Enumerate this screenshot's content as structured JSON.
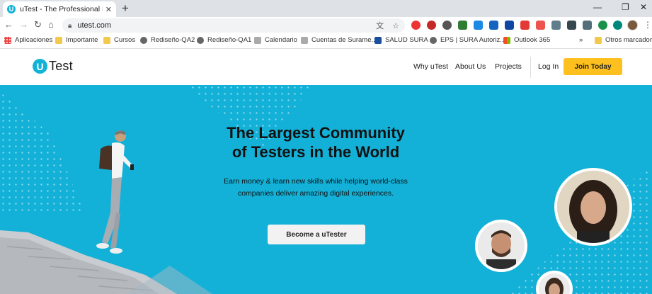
{
  "browser": {
    "tab_title": "uTest - The Professional Network",
    "tab_favicon": "U",
    "url": "utest.com",
    "bookmarks": [
      {
        "label": "Aplicaciones",
        "icon": "apps-icon"
      },
      {
        "label": "Importante",
        "icon": "folder-icon"
      },
      {
        "label": "Cursos",
        "icon": "folder-icon"
      },
      {
        "label": "Rediseño-QA2",
        "icon": "globe-icon"
      },
      {
        "label": "Rediseño-QA1",
        "icon": "globe-icon"
      },
      {
        "label": "Calendario",
        "icon": "calendar-icon"
      },
      {
        "label": "Cuentas de Surame...",
        "icon": "link-icon"
      },
      {
        "label": "SALUD SURA",
        "icon": "sura-icon"
      },
      {
        "label": "EPS | SURA Autoriz...",
        "icon": "globe-icon"
      },
      {
        "label": "Outlook 365",
        "icon": "microsoft-icon"
      }
    ],
    "more_bookmarks": "»",
    "other_bookmarks": "Otros marcadores"
  },
  "header": {
    "logo_letter": "U",
    "logo_text": "Test",
    "nav": [
      "Why uTest",
      "About Us",
      "Projects"
    ],
    "login": "Log In",
    "join": "Join Today"
  },
  "hero": {
    "headline_line1": "The Largest Community",
    "headline_line2": "of Testers in the World",
    "subtext_line1": "Earn money & learn new skills while helping world-class",
    "subtext_line2": "companies deliver amazing digital experiences.",
    "cta": "Become a uTester"
  },
  "colors": {
    "brand": "#12b3d6",
    "hero_bg": "#13b1d8",
    "join_button": "#fec01e"
  }
}
